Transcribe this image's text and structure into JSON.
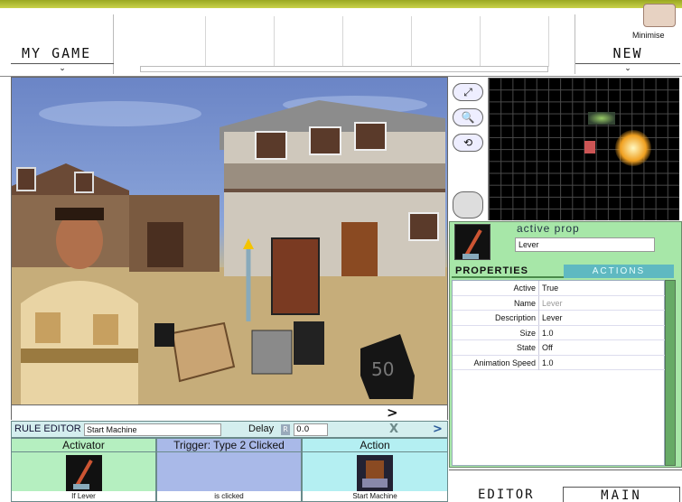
{
  "top": {
    "project_label": "MY GAME",
    "new_label": "NEW",
    "minimise_label": "Minimise",
    "chevron": "⌄"
  },
  "viewport": {
    "next_arrow": ">",
    "crate_number": "50"
  },
  "rule_editor": {
    "title": "RULE EDITOR",
    "rule_name": "Start Machine",
    "delay_label": "Delay",
    "delay_r": "R",
    "delay_value": "0.0",
    "delete_glyph": "X",
    "next_glyph": ">",
    "columns": [
      {
        "header": "Activator",
        "footer": "If Lever",
        "color": "#b5efc0"
      },
      {
        "header": "Trigger: Type 2 Clicked",
        "footer": "is clicked",
        "color": "#a9b9e8"
      },
      {
        "header": "Action",
        "footer": "Start Machine",
        "color": "#b4eff2"
      }
    ]
  },
  "properties_panel": {
    "active_prop_label": "active prop",
    "active_prop_value": "Lever",
    "tab_properties": "PROPERTIES",
    "tab_actions": "ACTIONS",
    "rows": [
      {
        "key": "Active",
        "value": "True"
      },
      {
        "key": "Name",
        "value": "Lever"
      },
      {
        "key": "Description",
        "value": "Lever"
      },
      {
        "key": "Size",
        "value": "1.0"
      },
      {
        "key": "State",
        "value": "Off"
      },
      {
        "key": "Animation Speed",
        "value": "1.0"
      }
    ]
  },
  "tools": [
    {
      "name": "fit-icon",
      "glyph": "⤢"
    },
    {
      "name": "zoom-icon",
      "glyph": "🔍"
    },
    {
      "name": "rotate-icon",
      "glyph": "⟲"
    }
  ],
  "bottom": {
    "editor_label": "EDITOR",
    "main_label": "MAIN"
  },
  "colors": {
    "accent_bar": "#9aa821",
    "panel_green": "#a7e7a8",
    "tab_teal": "#5fb9c1"
  }
}
